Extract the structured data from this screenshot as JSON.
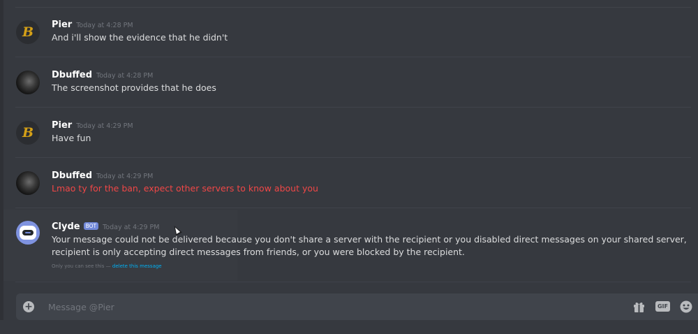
{
  "messages": [
    {
      "author": "Pier",
      "timestamp": "Today at 4:28 PM",
      "avatar_icon": "golden-b-logo",
      "content": "And i'll show the evidence that he didn't"
    },
    {
      "author": "Dbuffed",
      "timestamp": "Today at 4:28 PM",
      "avatar_icon": "profile-photo",
      "content": "The screenshot provides that he does"
    },
    {
      "author": "Pier",
      "timestamp": "Today at 4:29 PM",
      "avatar_icon": "golden-b-logo",
      "content": "Have fun"
    },
    {
      "author": "Dbuffed",
      "timestamp": "Today at 4:29 PM",
      "avatar_icon": "profile-photo",
      "content": "Lmao ty for the ban, expect other servers to know about you",
      "content_color": "#f04747"
    },
    {
      "author": "Clyde",
      "badge": "BOT",
      "timestamp": "Today at 4:29 PM",
      "avatar_icon": "clyde-bot-icon",
      "content": "Your message could not be delivered because you don't share a server with the recipient or you disabled direct messages on your shared server, recipient is only accepting direct messages from friends, or you were blocked by the recipient.",
      "note_prefix": "Only you can see this —",
      "note_link": "delete this message"
    }
  ],
  "composer": {
    "placeholder": "Message @Pier",
    "gif_label": "GIF",
    "add_icon": "plus-circle-icon",
    "gift_icon": "gift-icon",
    "emoji_icon": "emoji-icon"
  },
  "colors": {
    "background": "#36393f",
    "input_background": "#40444b",
    "error_text": "#f04747",
    "bot_badge": "#7289da",
    "link": "#00b0f4",
    "pier_logo": "#d4a017"
  }
}
